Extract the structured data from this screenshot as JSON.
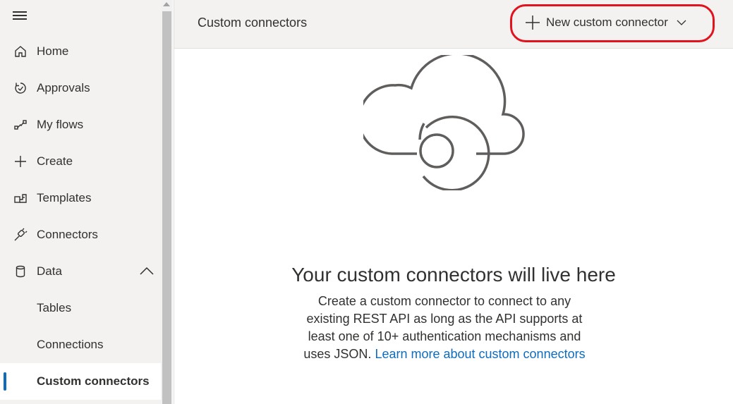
{
  "header": {
    "title": "Custom connectors",
    "new_button_label": "New custom connector"
  },
  "sidebar": {
    "items": [
      {
        "label": "Home"
      },
      {
        "label": "Approvals"
      },
      {
        "label": "My flows"
      },
      {
        "label": "Create"
      },
      {
        "label": "Templates"
      },
      {
        "label": "Connectors"
      },
      {
        "label": "Data"
      },
      {
        "label": "Tables"
      },
      {
        "label": "Connections"
      },
      {
        "label": "Custom connectors"
      }
    ],
    "selected": "Custom connectors"
  },
  "empty_state": {
    "title": "Your custom connectors will live here",
    "description": "Create a custom connector to connect to any existing REST API as long as the API supports at least one of 10+ authentication mechanisms and uses JSON.",
    "link_label": "Learn more about custom connectors"
  },
  "colors": {
    "accent": "#0f6cbd",
    "highlight": "#e0131f",
    "sidebar_bg": "#f3f2f1"
  }
}
